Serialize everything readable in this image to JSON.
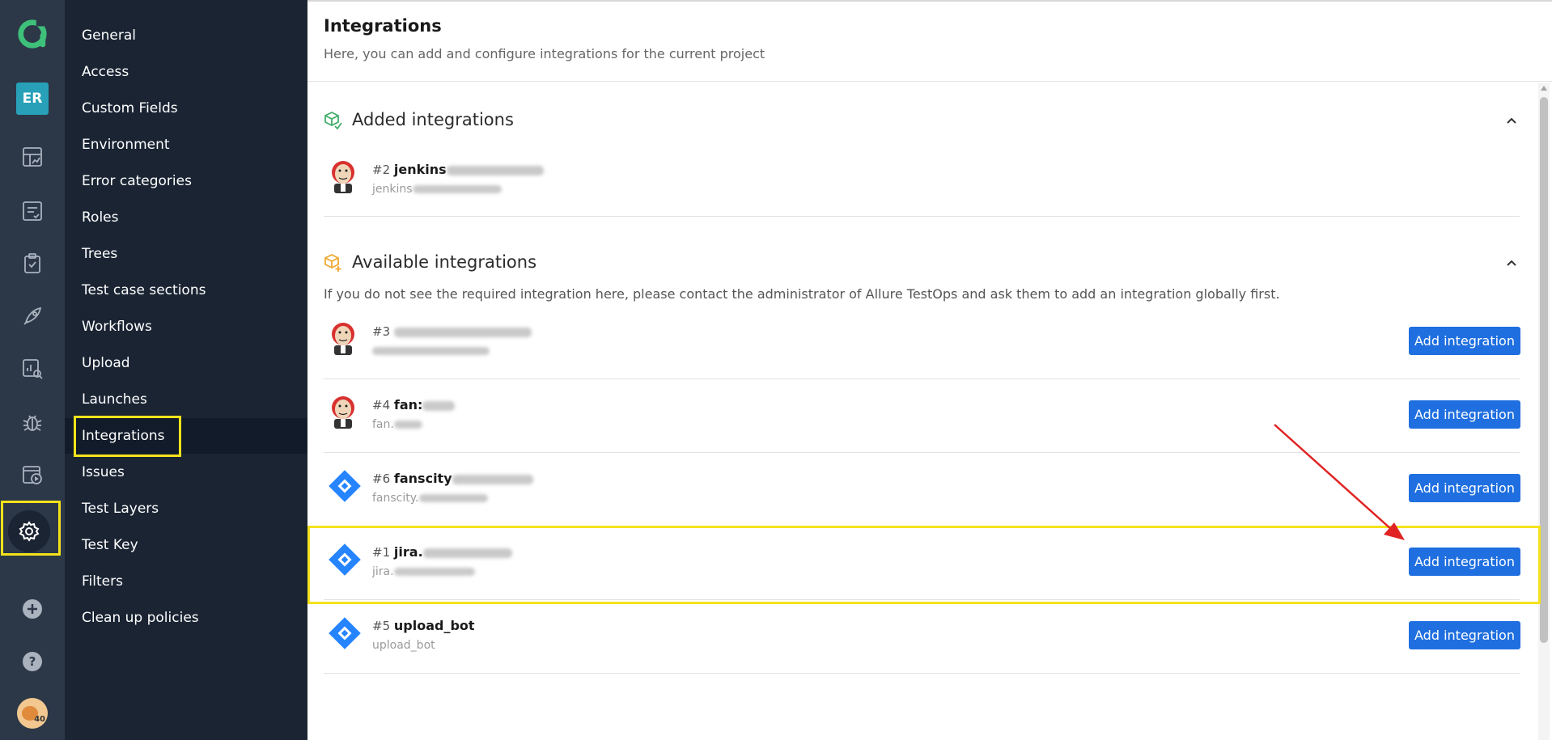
{
  "rail": {
    "logo_icon": "allure-logo-icon",
    "project_badge": "ER",
    "icons": [
      "dashboard-icon",
      "testcases-icon",
      "testplans-icon",
      "launches-icon",
      "analytics-icon",
      "defects-icon",
      "jobs-icon",
      "settings-icon",
      "add-icon",
      "help-icon"
    ],
    "avatar_badge": "40"
  },
  "nav": {
    "items": [
      {
        "label": "General"
      },
      {
        "label": "Access"
      },
      {
        "label": "Custom Fields"
      },
      {
        "label": "Environment"
      },
      {
        "label": "Error categories"
      },
      {
        "label": "Roles"
      },
      {
        "label": "Trees"
      },
      {
        "label": "Test case sections"
      },
      {
        "label": "Workflows"
      },
      {
        "label": "Upload"
      },
      {
        "label": "Launches"
      },
      {
        "label": "Integrations"
      },
      {
        "label": "Issues"
      },
      {
        "label": "Test Layers"
      },
      {
        "label": "Test Key"
      },
      {
        "label": "Filters"
      },
      {
        "label": "Clean up policies"
      }
    ],
    "active": "Integrations"
  },
  "header": {
    "title": "Integrations",
    "subtitle": "Here, you can add and configure integrations for the current project"
  },
  "added": {
    "title": "Added integrations",
    "items": [
      {
        "id": "#2",
        "name": "jenkins",
        "sub": "jenkins",
        "icon": "jenkins-logo-icon"
      }
    ]
  },
  "available": {
    "title": "Available integrations",
    "notice": "If you do not see the required integration here, please contact the administrator of Allure TestOps and ask them to add an integration globally first.",
    "button_label": "Add integration",
    "items": [
      {
        "id": "#3",
        "name": "",
        "sub": "",
        "icon": "jenkins-logo-icon"
      },
      {
        "id": "#4",
        "name": "fan:",
        "sub": "fan.",
        "icon": "jenkins-logo-icon"
      },
      {
        "id": "#6",
        "name": "fanscity",
        "sub": "fanscity.",
        "icon": "jira-logo-icon"
      },
      {
        "id": "#1",
        "name": "jira.",
        "sub": "jira.",
        "icon": "jira-logo-icon"
      },
      {
        "id": "#5",
        "name": "upload_bot",
        "sub": "upload_bot",
        "icon": "jira-logo-icon"
      }
    ]
  },
  "colors": {
    "accent": "#1f6fe0",
    "highlight": "#f5e21b",
    "arrow": "#e02424",
    "nav_bg": "#1a2433",
    "rail_bg": "#2c3848"
  }
}
